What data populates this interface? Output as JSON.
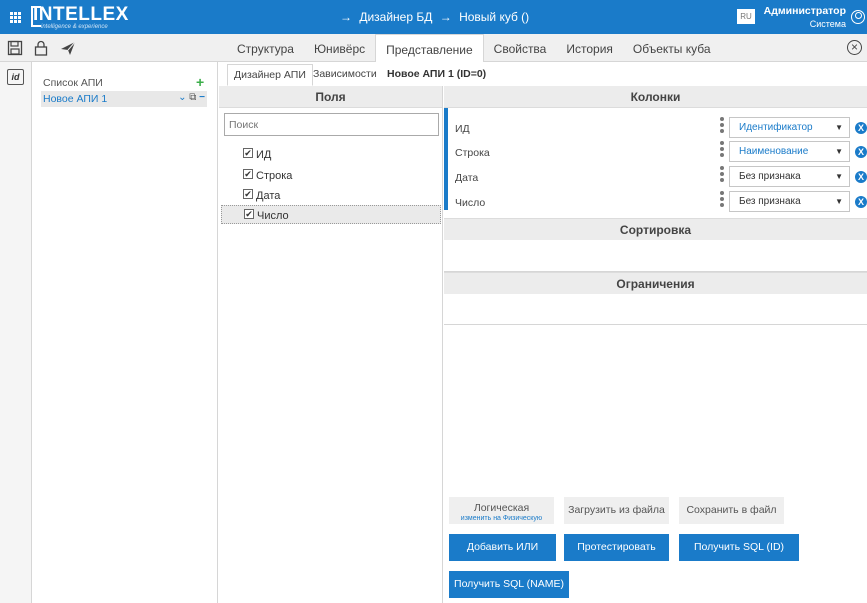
{
  "header": {
    "logo_text": "INTELLEX",
    "logo_tagline": "intelligence & experience",
    "breadcrumbs": [
      "Дизайнер БД",
      "Новый куб ()"
    ],
    "lang": "RU",
    "user_name": "Администратор",
    "user_role": "Система"
  },
  "tabs": [
    "Структура",
    "Юнивёрс",
    "Представление",
    "Свойства",
    "История",
    "Объекты куба"
  ],
  "active_tab": "Представление",
  "rail": {
    "button_label": "id"
  },
  "api_list": {
    "title": "Список АПИ",
    "items": [
      {
        "label": "Новое АПИ 1"
      }
    ]
  },
  "subtabs": [
    "Дизайнер АПИ",
    "Зависимости"
  ],
  "api_title": "Новое АПИ 1 (ID=0)",
  "fields": {
    "title": "Поля",
    "search_placeholder": "Поиск",
    "items": [
      {
        "label": "ИД",
        "checked": true
      },
      {
        "label": "Строка",
        "checked": true
      },
      {
        "label": "Дата",
        "checked": true
      },
      {
        "label": "Число",
        "checked": true
      }
    ]
  },
  "columns": {
    "title": "Колонки",
    "rows": [
      {
        "name": "ИД",
        "value": "Идентификатор"
      },
      {
        "name": "Строка",
        "value": "Наименование"
      },
      {
        "name": "Дата",
        "value": "Без признака"
      },
      {
        "name": "Число",
        "value": "Без признака"
      }
    ]
  },
  "sorting_title": "Сортировка",
  "limits_title": "Ограничения",
  "buttons": {
    "logical": "Логическая",
    "logical_sub": "изменить на Физическую",
    "load": "Загрузить из файла",
    "save": "Сохранить в файл",
    "add_or": "Добавить ИЛИ",
    "test": "Протестировать",
    "get_sql_id": "Получить SQL (ID)",
    "get_sql_name": "Получить SQL (NAME)"
  },
  "colors": {
    "accent": "#1a7bc9",
    "add_green": "#3cae4a"
  }
}
